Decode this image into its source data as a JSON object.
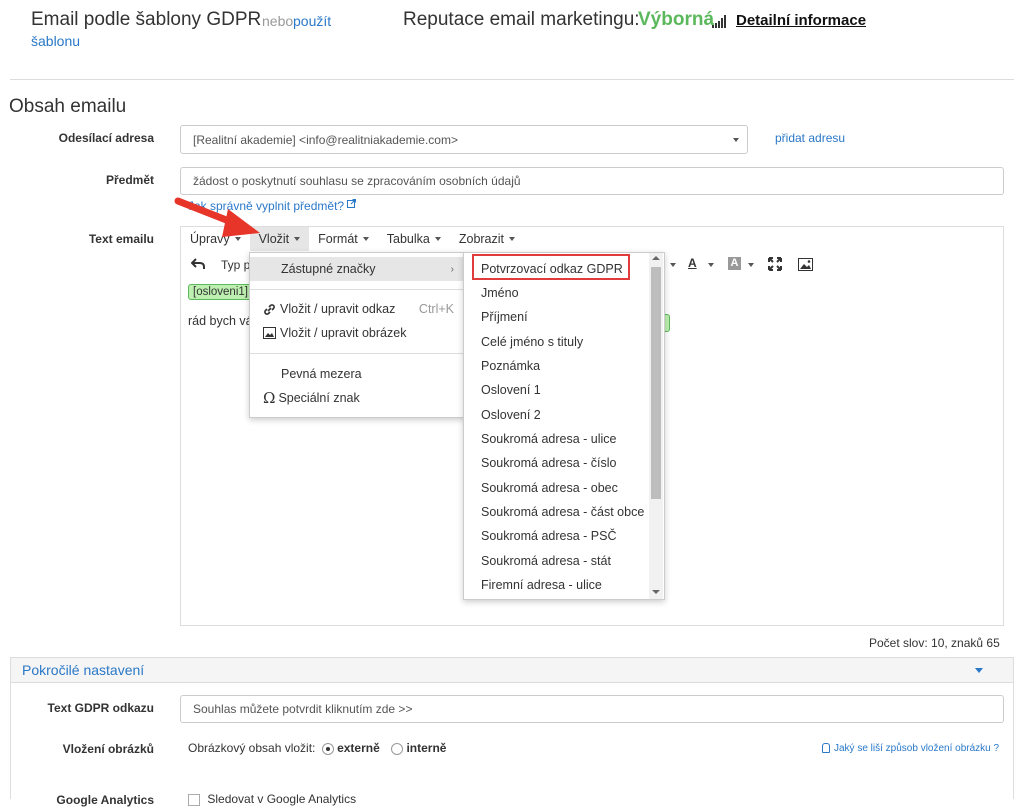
{
  "header": {
    "title": "Email podle šablony GDPR",
    "or_text": "nebo",
    "use_template_link_part1": "použít",
    "use_template_link_part2": "šablonu",
    "reputation_label": "Reputace email marketingu:",
    "reputation_value": "Výborná",
    "detail_link": "Detailní informace"
  },
  "section": {
    "title": "Obsah emailu"
  },
  "sender": {
    "label": "Odesílací adresa",
    "value": "[Realitní akademie] <info@realitniakademie.com>",
    "add_link": "přidat adresu"
  },
  "subject": {
    "label": "Předmět",
    "value": "žádost o poskytnutí souhlasu se zpracováním osobních údajů",
    "help_link": "Jak správně vyplnit předmět?"
  },
  "editor": {
    "label": "Text emailu",
    "menus": [
      "Úpravy",
      "Vložit",
      "Formát",
      "Tabulka",
      "Zobrazit"
    ],
    "toolbar_format_label": "Typ p",
    "placeholder_tag": "[osloveni1]",
    "body_text": "rád bych vá",
    "word_count": "Počet slov: 10, znaků 65"
  },
  "insert_menu": {
    "placeholders": "Zástupné značky",
    "insert_link": "Vložit / upravit odkaz",
    "insert_link_shortcut": "Ctrl+K",
    "insert_image": "Vložit / upravit obrázek",
    "nbsp": "Pevná mezera",
    "special_char": "Speciální znak"
  },
  "placeholder_submenu": [
    "Potvrzovací odkaz GDPR",
    "Jméno",
    "Příjmení",
    "Celé jméno s tituly",
    "Poznámka",
    "Oslovení 1",
    "Oslovení 2",
    "Soukromá adresa - ulice",
    "Soukromá adresa - číslo",
    "Soukromá adresa - obec",
    "Soukromá adresa - část obce",
    "Soukromá adresa - PSČ",
    "Soukromá adresa - stát",
    "Firemní adresa - ulice"
  ],
  "advanced": {
    "title": "Pokročilé nastavení",
    "gdpr_label": "Text GDPR odkazu",
    "gdpr_value": "Souhlas můžete potvrdit kliknutím zde >>",
    "images_label": "Vložení obrázků",
    "images_prefix": "Obrázkový obsah vložit:",
    "images_external": "externě",
    "images_internal": "interně",
    "images_help": "Jaký se liší způsob vložení obrázku ?",
    "ga_label": "Google Analytics",
    "ga_checkbox": "Sledovat v Google Analytics"
  },
  "colors": {
    "accent": "#2a78c8",
    "success": "#5cb85c",
    "highlight": "#e03c3c"
  }
}
